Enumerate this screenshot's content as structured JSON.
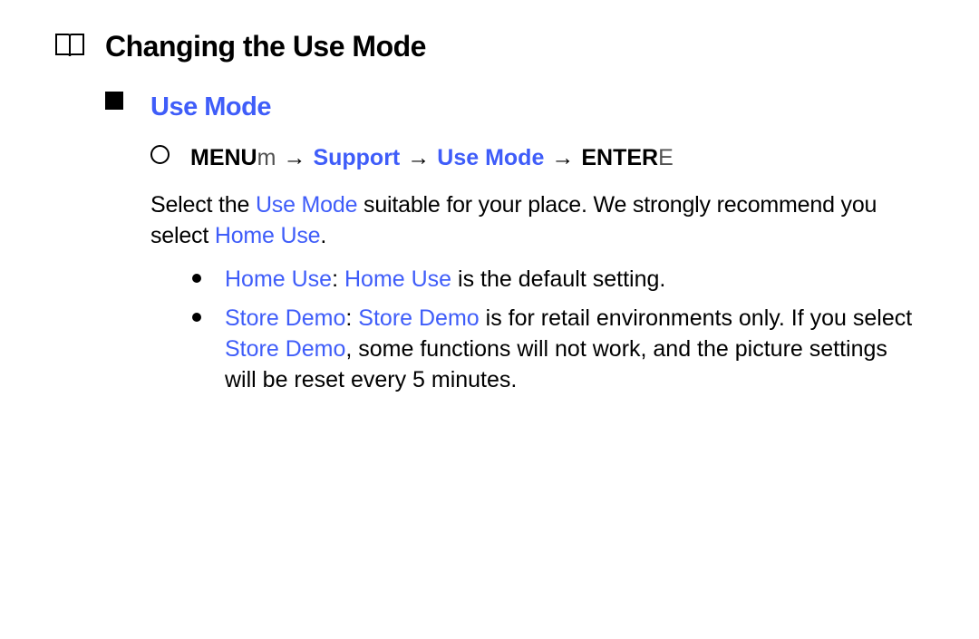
{
  "title": "Changing the Use Mode",
  "subtitle": "Use Mode",
  "path": {
    "menu_label": "MENU",
    "menu_suffix": "m",
    "support": "Support",
    "use_mode": "Use Mode",
    "enter_label": "ENTER",
    "enter_suffix": "E",
    "arrow": "→"
  },
  "body": {
    "p1a": "Select the ",
    "p1b": "Use Mode",
    "p1c": " suitable for your place. We strongly recommend you select ",
    "p1d": "Home Use",
    "p1e": "."
  },
  "bullets": [
    {
      "t1_kw": "Home Use",
      "t2": ": ",
      "t3_kw": "Home Use",
      "t4": " is the default setting."
    },
    {
      "t1_kw": "Store Demo",
      "t2": ": ",
      "t3_kw": "Store Demo",
      "t4": " is for retail environments only. If you select ",
      "t5_kw": "Store Demo",
      "t6": ", some functions will not work, and the picture settings will be reset every 5 minutes."
    }
  ]
}
